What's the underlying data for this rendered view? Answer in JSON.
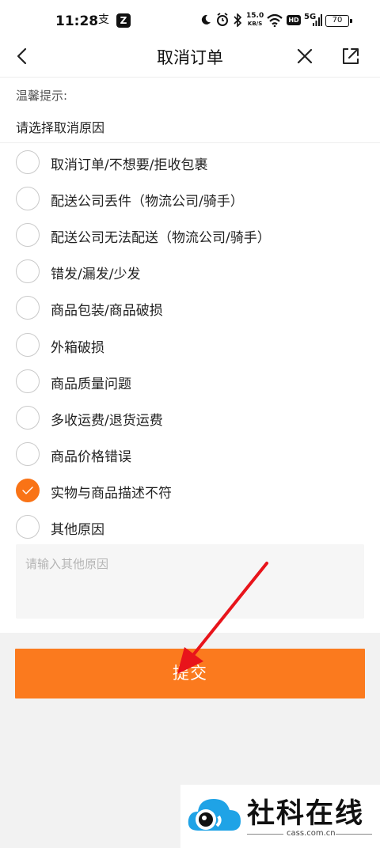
{
  "status_bar": {
    "time": "11:28",
    "speed_value": "15.0",
    "speed_unit": "KB/S",
    "hd": "HD",
    "network": "5G",
    "battery": "70"
  },
  "header": {
    "title": "取消订单"
  },
  "tip": {
    "title": "温馨提示:",
    "choose_label": "请选择取消原因"
  },
  "reasons": [
    {
      "label": "取消订单/不想要/拒收包裹",
      "checked": false
    },
    {
      "label": "配送公司丢件（物流公司/骑手）",
      "checked": false
    },
    {
      "label": "配送公司无法配送（物流公司/骑手）",
      "checked": false
    },
    {
      "label": "错发/漏发/少发",
      "checked": false
    },
    {
      "label": "商品包装/商品破损",
      "checked": false
    },
    {
      "label": "外箱破损",
      "checked": false
    },
    {
      "label": "商品质量问题",
      "checked": false
    },
    {
      "label": "多收运费/退货运费",
      "checked": false
    },
    {
      "label": "商品价格错误",
      "checked": false
    },
    {
      "label": "实物与商品描述不符",
      "checked": true
    },
    {
      "label": "其他原因",
      "checked": false
    }
  ],
  "other_input": {
    "placeholder": "请输入其他原因",
    "value": ""
  },
  "submit_label": "提交",
  "colors": {
    "accent": "#fb7a1e",
    "annotation_arrow": "#e8141b"
  },
  "watermark": {
    "text": "社科在线",
    "url": "cass.com.cn"
  }
}
